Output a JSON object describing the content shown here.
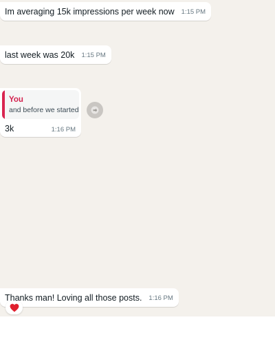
{
  "messages": [
    {
      "text": "Im averaging 15k impressions per week now",
      "time": "1:15 PM"
    },
    {
      "text": "last week was 20k",
      "time": "1:15 PM"
    },
    {
      "quoted": {
        "author": "You",
        "text": "and before we started?"
      },
      "text": "3k",
      "time": "1:16 PM"
    },
    {
      "text": "Thanks man! Loving all those posts.",
      "time": "1:16 PM"
    }
  ],
  "reaction": {
    "emoji": "heart",
    "color": "#e0202e"
  },
  "colors": {
    "chat_background": "#f4f1ec",
    "quote_accent": "#d92550",
    "quote_author": "#d3224f"
  },
  "icons": {
    "forward_button": "forward-icon"
  }
}
